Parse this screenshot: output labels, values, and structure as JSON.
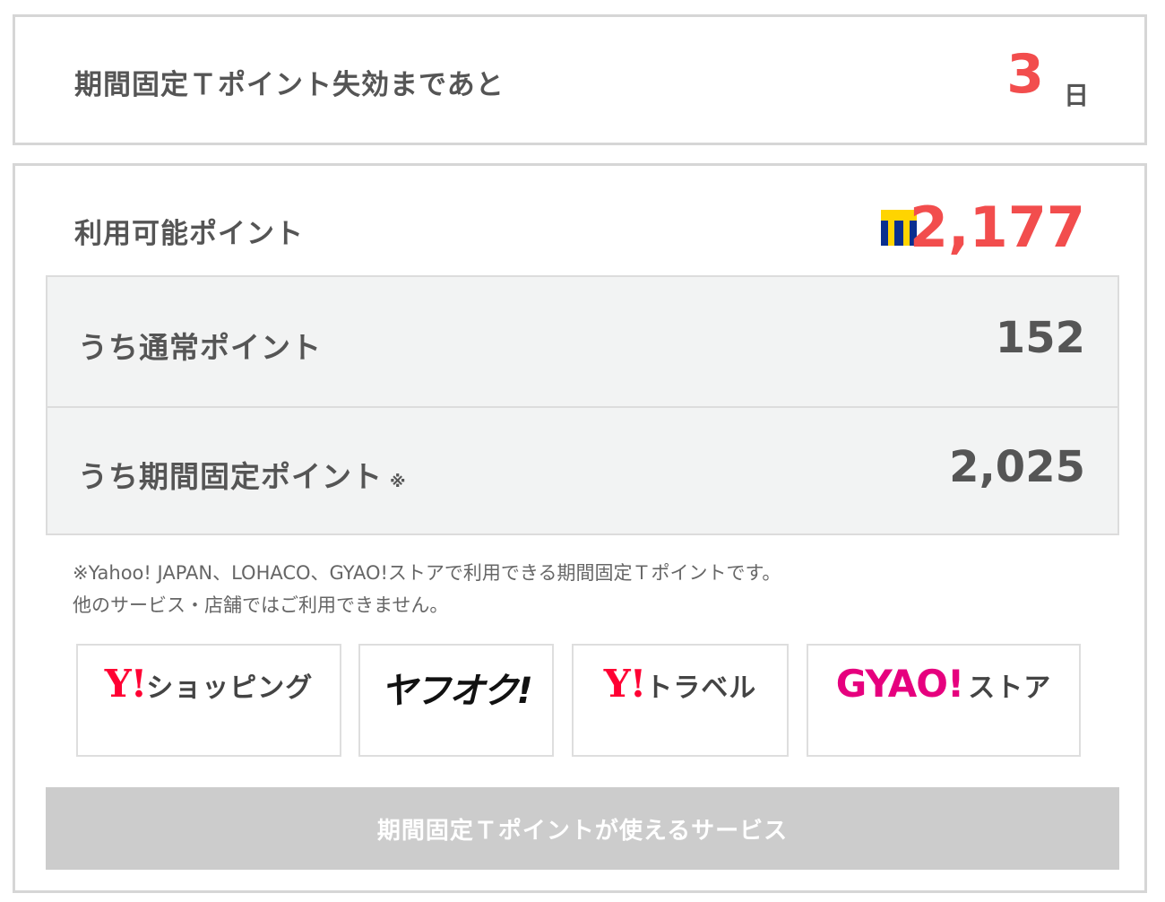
{
  "expiry": {
    "label": "期間固定Ｔポイント失効まであと",
    "days": "3",
    "unit": "日"
  },
  "points": {
    "available_label": "利用可能ポイント",
    "available_value": "2,177",
    "normal_label": "うち通常ポイント",
    "normal_value": "152",
    "fixed_label": "うち期間固定ポイント",
    "fixed_mark": "※",
    "fixed_value": "2,025"
  },
  "note": {
    "line1": "※Yahoo! JAPAN、LOHACO、GYAO!ストアで利用できる期間固定Ｔポイントです。",
    "line2": "他のサービス・店舗ではご利用できません。"
  },
  "services": {
    "shopping": {
      "logo": "Y!",
      "name": "ショッピング"
    },
    "auction": {
      "logo": "ヤフオク!"
    },
    "travel": {
      "logo": "Y!",
      "name": "トラベル"
    },
    "gyao": {
      "logo": "GYAO!",
      "name": "ストア"
    }
  },
  "cta": {
    "label": "期間固定Ｔポイントが使えるサービス"
  },
  "icons": {
    "t_logo": "t-point-icon"
  },
  "colors": {
    "accent": "#f24d4d",
    "yahoo_red": "#ff0033",
    "gyao_pink": "#e6007e",
    "t_blue": "#0a2f8f",
    "t_yellow": "#ffd400",
    "cta_bg": "#cccccc"
  }
}
